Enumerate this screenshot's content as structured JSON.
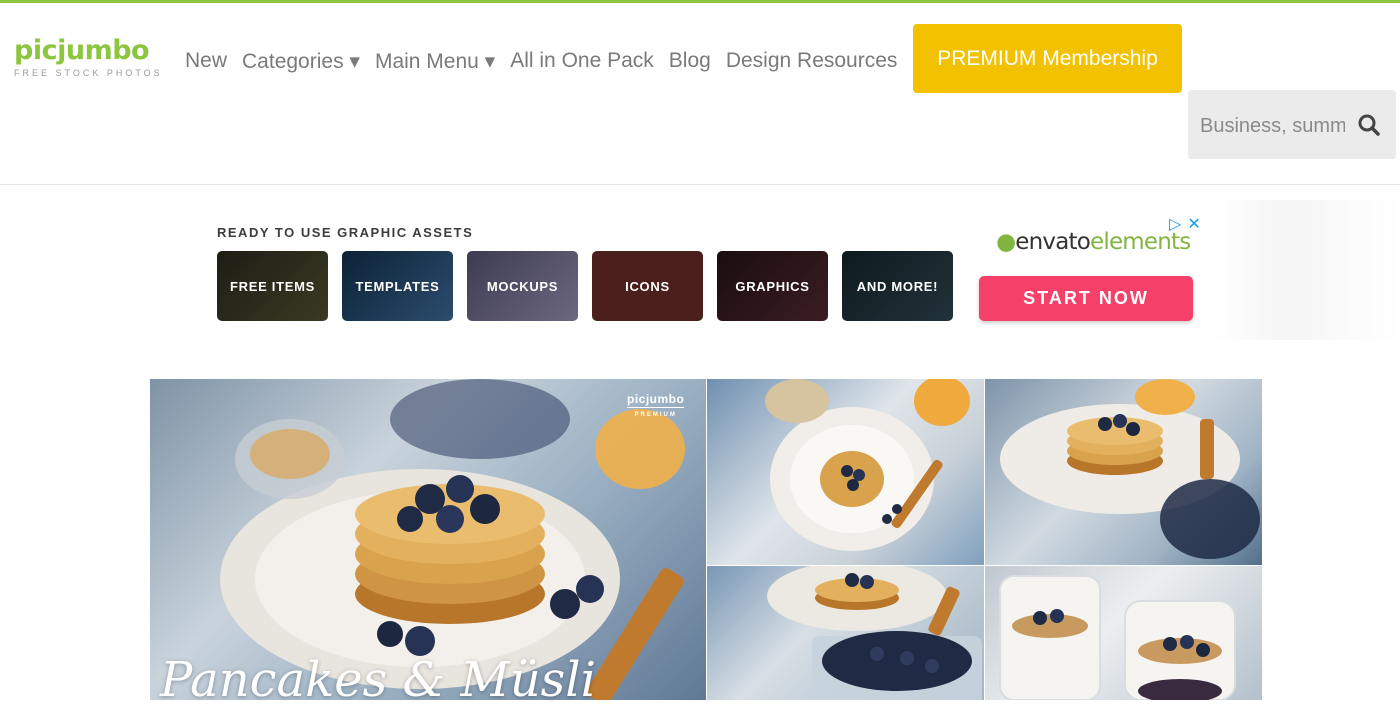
{
  "logo": {
    "name": "picjumbo",
    "tagline": "FREE STOCK PHOTOS"
  },
  "nav": {
    "items": [
      "New",
      "Categories ▾",
      "Main Menu ▾",
      "All in One Pack",
      "Blog",
      "Design Resources"
    ],
    "premium_label": "PREMIUM Membership"
  },
  "search": {
    "placeholder": "Business, summer, food...",
    "icon": "search-icon"
  },
  "ad": {
    "heading": "READY TO USE GRAPHIC ASSETS",
    "tiles": [
      "FREE ITEMS",
      "TEMPLATES",
      "MOCKUPS",
      "ICONS",
      "GRAPHICS",
      "AND MORE!"
    ],
    "brand_prefix": "envato",
    "brand_suffix": "elements",
    "cta": "START NOW",
    "cta_color": "#f5406a",
    "icons": [
      "adchoices-icon",
      "close-icon"
    ]
  },
  "gallery": {
    "feature_title": "Pancakes & Müsli",
    "brand_mark": "picjumbo",
    "brand_sub": "PREMIUM"
  },
  "colors": {
    "brand_green": "#8cc63f",
    "premium_yellow": "#f2c200"
  }
}
